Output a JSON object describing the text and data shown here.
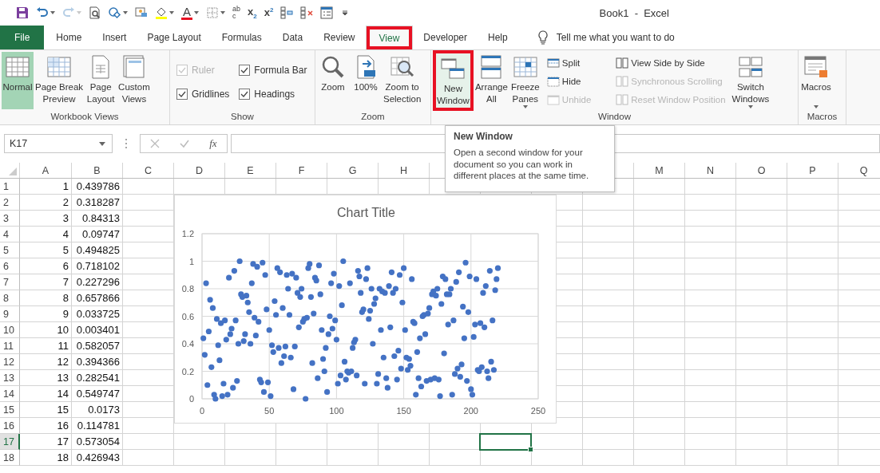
{
  "title_bar": {
    "title": "Book1  -  Excel",
    "quick_access": [
      {
        "kind": "save",
        "dropdown": false,
        "disabled": false
      },
      {
        "kind": "undo",
        "dropdown": true,
        "disabled": false
      },
      {
        "kind": "redo",
        "dropdown": true,
        "disabled": true
      },
      {
        "kind": "preview",
        "dropdown": false,
        "disabled": false
      },
      {
        "kind": "shapes",
        "dropdown": true,
        "disabled": false
      },
      {
        "kind": "picture",
        "dropdown": false,
        "disabled": false
      },
      {
        "kind": "fill",
        "dropdown": true,
        "disabled": false
      },
      {
        "kind": "fontcolor",
        "dropdown": true,
        "disabled": false,
        "label": "A"
      },
      {
        "kind": "borders",
        "dropdown": true,
        "disabled": false
      },
      {
        "kind": "spelling",
        "dropdown": false,
        "disabled": false,
        "label": "ab",
        "mark": "c"
      },
      {
        "kind": "subscript",
        "dropdown": false,
        "disabled": false,
        "label": "x",
        "mark": "2"
      },
      {
        "kind": "superscript",
        "dropdown": false,
        "disabled": false,
        "label": "x",
        "mark": "2"
      },
      {
        "kind": "structure",
        "dropdown": false,
        "disabled": false
      },
      {
        "kind": "structure-remove",
        "dropdown": false,
        "disabled": false
      },
      {
        "kind": "form",
        "dropdown": false,
        "disabled": false
      },
      {
        "kind": "customize",
        "dropdown": false,
        "disabled": false
      }
    ]
  },
  "tabs": [
    {
      "label": "File",
      "kind": "file",
      "selected": false,
      "highlighted": false
    },
    {
      "label": "Home",
      "kind": "tab",
      "selected": false,
      "highlighted": false
    },
    {
      "label": "Insert",
      "kind": "tab",
      "selected": false,
      "highlighted": false
    },
    {
      "label": "Page Layout",
      "kind": "tab",
      "selected": false,
      "highlighted": false
    },
    {
      "label": "Formulas",
      "kind": "tab",
      "selected": false,
      "highlighted": false
    },
    {
      "label": "Data",
      "kind": "tab",
      "selected": false,
      "highlighted": false
    },
    {
      "label": "Review",
      "kind": "tab",
      "selected": false,
      "highlighted": false
    },
    {
      "label": "View",
      "kind": "tab",
      "selected": true,
      "highlighted": true
    },
    {
      "label": "Developer",
      "kind": "tab",
      "selected": false,
      "highlighted": false
    },
    {
      "label": "Help",
      "kind": "tab",
      "selected": false,
      "highlighted": false
    }
  ],
  "tell_me": {
    "placeholder": "Tell me what you want to do"
  },
  "ribbon": [
    {
      "label": "Workbook Views",
      "items": [
        {
          "kind": "large",
          "label": "Normal",
          "selected": true,
          "highlighted": false,
          "dropdown": false
        },
        {
          "kind": "large",
          "label": "Page Break\nPreview",
          "selected": false,
          "highlighted": false,
          "dropdown": false
        },
        {
          "kind": "large",
          "label": "Page\nLayout",
          "selected": false,
          "highlighted": false,
          "dropdown": false
        },
        {
          "kind": "large",
          "label": "Custom\nViews",
          "selected": false,
          "highlighted": false,
          "dropdown": false
        }
      ]
    },
    {
      "label": "Show",
      "items": [
        {
          "kind": "checks",
          "items": [
            {
              "label": "Ruler",
              "checked": true,
              "disabled": true
            },
            {
              "label": "Gridlines",
              "checked": true,
              "disabled": false
            },
            {
              "label": "Formula Bar",
              "checked": true,
              "disabled": false
            },
            {
              "label": "Headings",
              "checked": true,
              "disabled": false
            }
          ]
        }
      ]
    },
    {
      "label": "Zoom",
      "items": [
        {
          "kind": "large",
          "label": "Zoom",
          "selected": false,
          "highlighted": false,
          "dropdown": false
        },
        {
          "kind": "large",
          "label": "100%",
          "selected": false,
          "highlighted": false,
          "dropdown": false
        },
        {
          "kind": "large",
          "label": "Zoom to\nSelection",
          "selected": false,
          "highlighted": false,
          "dropdown": false
        }
      ]
    },
    {
      "label": "Window",
      "items": [
        {
          "kind": "large",
          "label": "New\nWindow",
          "selected": false,
          "highlighted": true,
          "dropdown": false
        },
        {
          "kind": "large",
          "label": "Arrange\nAll",
          "selected": false,
          "highlighted": false,
          "dropdown": false
        },
        {
          "kind": "large",
          "label": "Freeze\nPanes",
          "selected": false,
          "highlighted": false,
          "dropdown": true
        },
        {
          "kind": "stack",
          "items": [
            {
              "label": "Split",
              "disabled": false
            },
            {
              "label": "Hide",
              "disabled": false
            },
            {
              "label": "Unhide",
              "disabled": true
            }
          ]
        },
        {
          "kind": "stack",
          "items": [
            {
              "label": "View Side by Side",
              "disabled": false
            },
            {
              "label": "Synchronous Scrolling",
              "disabled": true
            },
            {
              "label": "Reset Window Position",
              "disabled": true
            }
          ]
        },
        {
          "kind": "large",
          "label": "Switch\nWindows",
          "selected": false,
          "highlighted": false,
          "dropdown": true
        }
      ]
    },
    {
      "label": "Macros",
      "items": [
        {
          "kind": "large",
          "label": "Macros",
          "selected": false,
          "highlighted": false,
          "dropdown": true
        }
      ]
    }
  ],
  "formula_bar": {
    "name_box": "K17",
    "function_label": "fx"
  },
  "sheet": {
    "columns": [
      "A",
      "B",
      "C",
      "D",
      "E",
      "F",
      "G",
      "H"
    ],
    "columns_after": [
      "M",
      "N",
      "O",
      "P",
      "Q"
    ],
    "rows": [
      {
        "number": "1",
        "a": "1",
        "b": "0.439786",
        "selected": false
      },
      {
        "number": "2",
        "a": "2",
        "b": "0.318287",
        "selected": false
      },
      {
        "number": "3",
        "a": "3",
        "b": "0.84313",
        "selected": false
      },
      {
        "number": "4",
        "a": "4",
        "b": "0.09747",
        "selected": false
      },
      {
        "number": "5",
        "a": "5",
        "b": "0.494825",
        "selected": false
      },
      {
        "number": "6",
        "a": "6",
        "b": "0.718102",
        "selected": false
      },
      {
        "number": "7",
        "a": "7",
        "b": "0.227296",
        "selected": false
      },
      {
        "number": "8",
        "a": "8",
        "b": "0.657866",
        "selected": false
      },
      {
        "number": "9",
        "a": "9",
        "b": "0.033725",
        "selected": false
      },
      {
        "number": "10",
        "a": "10",
        "b": "0.003401",
        "selected": false
      },
      {
        "number": "11",
        "a": "11",
        "b": "0.582057",
        "selected": false
      },
      {
        "number": "12",
        "a": "12",
        "b": "0.394366",
        "selected": false
      },
      {
        "number": "13",
        "a": "13",
        "b": "0.282541",
        "selected": false
      },
      {
        "number": "14",
        "a": "14",
        "b": "0.549747",
        "selected": false
      },
      {
        "number": "15",
        "a": "15",
        "b": "0.0173",
        "selected": false
      },
      {
        "number": "16",
        "a": "16",
        "b": "0.114781",
        "selected": false
      },
      {
        "number": "17",
        "a": "17",
        "b": "0.573054",
        "selected": true
      },
      {
        "number": "18",
        "a": "18",
        "b": "0.426943",
        "selected": false
      }
    ]
  },
  "chart_data": {
    "type": "scatter",
    "title": "Chart Title",
    "grid": true,
    "xlim": [
      0,
      250
    ],
    "ylim": [
      0,
      1.2
    ],
    "xticks": [
      0,
      50,
      100,
      150,
      200,
      250
    ],
    "yticks": [
      0,
      0.2,
      0.4,
      0.6,
      0.8,
      1,
      1.2
    ],
    "series": [
      {
        "color": "#4472c4",
        "x": [
          1,
          2,
          3,
          4,
          5,
          6,
          7,
          8,
          9,
          10,
          11,
          12,
          13,
          14,
          15,
          16,
          17,
          18,
          19,
          20,
          21,
          22,
          23,
          24,
          25,
          26,
          27,
          28,
          29,
          30,
          31,
          32,
          33,
          34,
          35,
          36,
          37,
          38,
          39,
          40,
          41,
          42,
          43,
          44,
          45,
          46,
          47,
          48,
          49,
          50,
          51,
          52,
          53,
          54,
          55,
          56,
          57,
          58,
          59,
          60,
          61,
          62,
          63,
          64,
          65,
          66,
          67,
          68,
          69,
          70,
          71,
          72,
          73,
          74,
          75,
          76,
          77,
          78,
          79,
          80,
          81,
          82,
          83,
          84,
          85,
          86,
          87,
          88,
          89,
          90,
          91,
          92,
          93,
          94,
          95,
          96,
          97,
          98,
          99,
          100,
          101,
          102,
          103,
          104,
          105,
          106,
          107,
          108,
          109,
          110,
          111,
          112,
          113,
          114,
          115,
          116,
          117,
          118,
          119,
          120,
          121,
          122,
          123,
          124,
          125,
          126,
          127,
          128,
          129,
          130,
          131,
          132,
          133,
          134,
          135,
          136,
          137,
          138,
          139,
          140,
          141,
          142,
          143,
          144,
          145,
          146,
          147,
          148,
          149,
          150,
          151,
          152,
          153,
          154,
          155,
          156,
          157,
          158,
          159,
          160,
          161,
          162,
          163,
          164,
          165,
          166,
          167,
          168,
          169,
          170,
          171,
          172,
          173,
          174,
          175,
          176,
          177,
          178,
          179,
          180,
          181,
          182,
          183,
          184,
          185,
          186,
          187,
          188,
          189,
          190,
          191,
          192,
          193,
          194,
          195,
          196,
          197,
          198,
          199,
          200,
          201,
          202,
          203,
          204,
          205,
          206,
          207,
          208,
          209,
          210,
          211,
          212,
          213,
          214,
          215,
          216,
          217,
          218,
          219,
          220
        ],
        "values": [
          0.44,
          0.32,
          0.84,
          0.1,
          0.49,
          0.72,
          0.23,
          0.66,
          0.03,
          0,
          0.58,
          0.39,
          0.28,
          0.55,
          0.02,
          0.11,
          0.57,
          0.43,
          0.03,
          0.88,
          0.47,
          0.51,
          0.08,
          0.93,
          0.57,
          0.13,
          0.4,
          1,
          0.76,
          0.74,
          0.42,
          0.47,
          0.75,
          0.7,
          0.63,
          0.4,
          0.84,
          0.98,
          0.59,
          0.46,
          0.96,
          0.56,
          0.14,
          0.12,
          0.99,
          0.05,
          0.9,
          0.65,
          0.12,
          0.5,
          0.02,
          0.39,
          0.34,
          0.71,
          0.61,
          0.95,
          0.37,
          0.92,
          0.26,
          0.66,
          0.31,
          0.38,
          0.9,
          0.8,
          0.61,
          0.3,
          0.91,
          0.07,
          0.38,
          0.88,
          0.77,
          0.52,
          0.74,
          0.8,
          0.56,
          0.58,
          0,
          0.59,
          0.95,
          0.98,
          0.74,
          0.26,
          0.62,
          0.88,
          0.86,
          0.15,
          0.97,
          0.76,
          0.5,
          0.29,
          0.2,
          0.37,
          0.05,
          0.47,
          0.6,
          0.84,
          0.51,
          0.91,
          0.57,
          0.43,
          0.11,
          0.82,
          0.17,
          0.68,
          1,
          0.27,
          0.14,
          0.2,
          0.19,
          0.84,
          0.2,
          0.37,
          0.41,
          0.43,
          0.17,
          0.93,
          0.89,
          0.77,
          0.63,
          0.65,
          0.11,
          0.87,
          0.95,
          0.58,
          0.64,
          0.8,
          0.4,
          0.69,
          0.73,
          0.11,
          0.18,
          0.8,
          0.5,
          0.78,
          0.3,
          0.77,
          0.15,
          0.08,
          0.82,
          0.52,
          0.92,
          0.77,
          0.31,
          0.8,
          0.14,
          0.35,
          0.9,
          0.22,
          0.7,
          0.95,
          0.5,
          0.3,
          0.21,
          0.29,
          0.24,
          0.87,
          0.56,
          0.55,
          0.03,
          0.34,
          0.15,
          0.44,
          0.09,
          0.6,
          0.61,
          0.47,
          0.13,
          0.62,
          0.66,
          0.14,
          0.76,
          0.78,
          0.15,
          0.75,
          0.8,
          0.14,
          0.02,
          0.69,
          0.89,
          0.33,
          0.87,
          0.76,
          0.54,
          0.76,
          0.8,
          0.03,
          0.57,
          0.18,
          0.85,
          0.22,
          0.92,
          0.16,
          0.25,
          0.67,
          0.44,
          0.99,
          0.13,
          0.63,
          0.89,
          0.07,
          0.03,
          0.45,
          0.54,
          0.87,
          0.21,
          0.2,
          0.55,
          0.23,
          0.77,
          0.52,
          0.82,
          0.2,
          0.15,
          0.93,
          0.27,
          0.57,
          0.21,
          0.79,
          0.87,
          0.95
        ]
      }
    ]
  },
  "tooltip": {
    "title": "New Window",
    "text": "Open a second window for your document so you can work in different places at the same time."
  }
}
